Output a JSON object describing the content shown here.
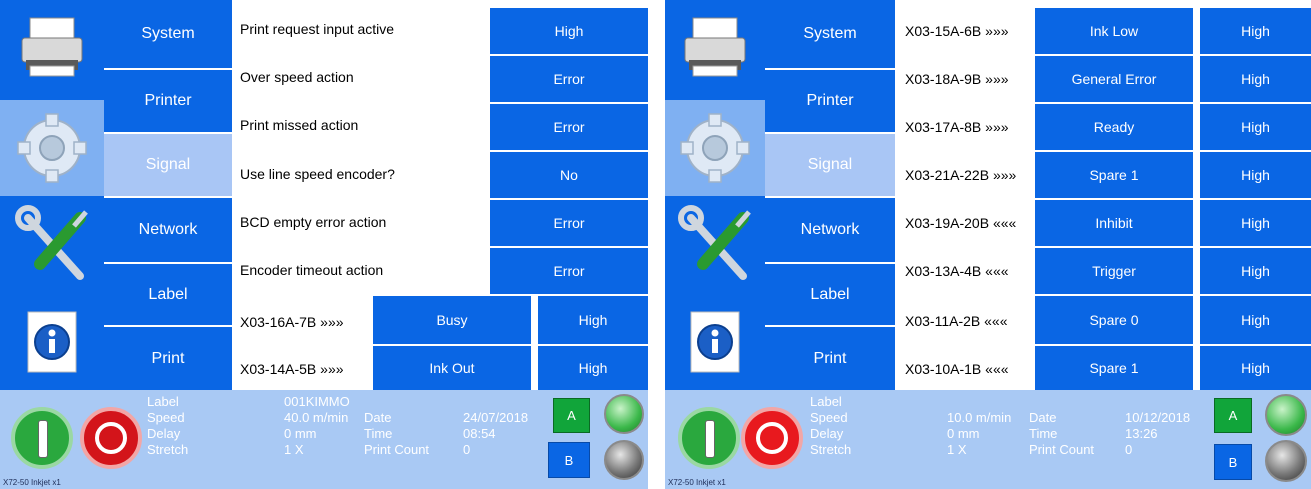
{
  "left": {
    "menu": [
      "System",
      "Printer",
      "Signal",
      "Network",
      "Label",
      "Print"
    ],
    "rows": [
      {
        "label": "Print request input active",
        "value": "High"
      },
      {
        "label": "Over speed action",
        "value": "Error"
      },
      {
        "label": "Print missed action",
        "value": "Error"
      },
      {
        "label": "Use line speed encoder?",
        "value": "No"
      },
      {
        "label": "BCD empty error action",
        "value": "Error"
      },
      {
        "label": "Encoder timeout action",
        "value": "Error"
      }
    ],
    "io_rows": [
      {
        "label": "X03-16A-7B »»»",
        "signal": "Busy",
        "level": "High"
      },
      {
        "label": "X03-14A-5B »»»",
        "signal": "Ink Out",
        "level": "High"
      }
    ],
    "status": {
      "label_key": "Label",
      "label_val": "001KIMMO",
      "speed_key": "Speed",
      "speed_val": "40.0 m/min",
      "delay_key": "Delay",
      "delay_val": "0 mm",
      "stretch_key": "Stretch",
      "stretch_val": "1 X",
      "date_key": "Date",
      "date_val": "24/07/2018",
      "time_key": "Time",
      "time_val": "08:54",
      "count_key": "Print Count",
      "count_val": "0",
      "a": "A",
      "b": "B",
      "footer": "X72-50 Inkjet x1"
    }
  },
  "right": {
    "menu": [
      "System",
      "Printer",
      "Signal",
      "Network",
      "Label",
      "Print"
    ],
    "io_rows": [
      {
        "label": "X03-15A-6B »»»",
        "signal": "Ink Low",
        "level": "High"
      },
      {
        "label": "X03-18A-9B »»»",
        "signal": "General Error",
        "level": "High"
      },
      {
        "label": "X03-17A-8B »»»",
        "signal": "Ready",
        "level": "High"
      },
      {
        "label": "X03-21A-22B »»»",
        "signal": "Spare 1",
        "level": "High"
      },
      {
        "label": "X03-19A-20B «««",
        "signal": "Inhibit",
        "level": "High"
      },
      {
        "label": "X03-13A-4B «««",
        "signal": "Trigger",
        "level": "High"
      },
      {
        "label": "X03-11A-2B «««",
        "signal": "Spare 0",
        "level": "High"
      },
      {
        "label": "X03-10A-1B «««",
        "signal": "Spare 1",
        "level": "High"
      }
    ],
    "status": {
      "label_key": "Label",
      "label_val": "",
      "speed_key": "Speed",
      "speed_val": "10.0 m/min",
      "delay_key": "Delay",
      "delay_val": "0 mm",
      "stretch_key": "Stretch",
      "stretch_val": "1 X",
      "date_key": "Date",
      "date_val": "10/12/2018",
      "time_key": "Time",
      "time_val": "13:26",
      "count_key": "Print Count",
      "count_val": "0",
      "a": "A",
      "b": "B",
      "footer": "X72-50 Inkjet x1"
    }
  },
  "colors": {
    "accent": "#0a66e4",
    "selected": "#a9c6f5",
    "status_bg": "#a9c9f4",
    "start_green": "#22a23a",
    "stop_red": "#d01818",
    "a_green": "#11a53a"
  },
  "icons": [
    "printer-icon",
    "gear-icon",
    "tools-icon",
    "info-icon",
    "start-icon",
    "stop-icon",
    "status-light-green-icon",
    "status-light-gray-icon"
  ]
}
